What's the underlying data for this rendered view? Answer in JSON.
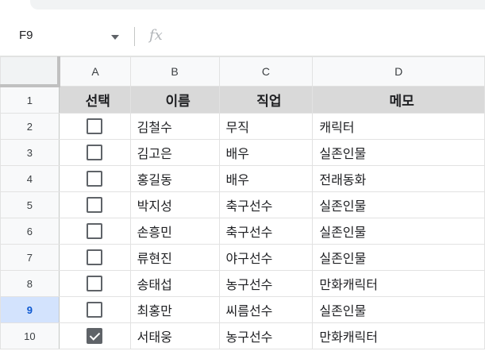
{
  "name_box": "F9",
  "fx_label": "fx",
  "columns": [
    "A",
    "B",
    "C",
    "D"
  ],
  "header": {
    "row_number": "1",
    "select": "선택",
    "name": "이름",
    "job": "직업",
    "memo": "메모"
  },
  "rows": [
    {
      "num": "2",
      "checked": false,
      "name": "김철수",
      "job": "무직",
      "memo": "캐릭터"
    },
    {
      "num": "3",
      "checked": false,
      "name": "김고은",
      "job": "배우",
      "memo": "실존인물"
    },
    {
      "num": "4",
      "checked": false,
      "name": "홍길동",
      "job": "배우",
      "memo": "전래동화"
    },
    {
      "num": "5",
      "checked": false,
      "name": "박지성",
      "job": "축구선수",
      "memo": "실존인물"
    },
    {
      "num": "6",
      "checked": false,
      "name": "손흥민",
      "job": "축구선수",
      "memo": "실존인물"
    },
    {
      "num": "7",
      "checked": false,
      "name": "류현진",
      "job": "야구선수",
      "memo": "실존인물"
    },
    {
      "num": "8",
      "checked": false,
      "name": "송태섭",
      "job": "농구선수",
      "memo": "만화캐릭터"
    },
    {
      "num": "9",
      "checked": false,
      "name": "최홍만",
      "job": "씨름선수",
      "memo": "실존인물"
    },
    {
      "num": "10",
      "checked": true,
      "name": "서태웅",
      "job": "농구선수",
      "memo": "만화캐릭터"
    }
  ],
  "selected_row": "9",
  "colors": {
    "header_fill": "#d9d9d9",
    "selected_row_header": "#d3e3fd",
    "selected_row_text": "#0b57d0"
  }
}
